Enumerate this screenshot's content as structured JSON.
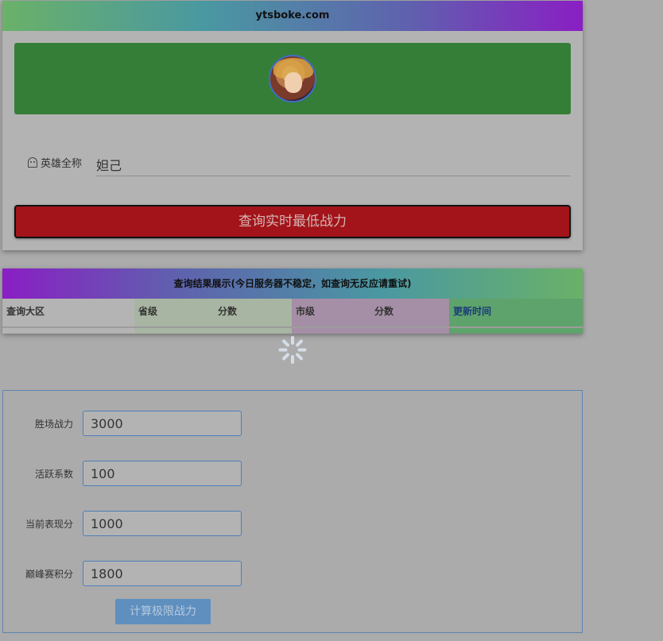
{
  "header": {
    "site_title": "ytsboke.com"
  },
  "hero": {
    "label": "英雄全称",
    "value": "妲己",
    "icon": "ghost-icon"
  },
  "query_button": {
    "label": "查询实时最低战力"
  },
  "results": {
    "title": "查询结果展示(今日服务器不稳定，如查询无反应请重试)",
    "columns": {
      "region": "查询大区",
      "province": "省级",
      "province_score": "分数",
      "city": "市级",
      "city_score": "分数",
      "updated": "更新时间"
    }
  },
  "calculator": {
    "fields": [
      {
        "label": "胜场战力",
        "value": "3000"
      },
      {
        "label": "活跃系数",
        "value": "100"
      },
      {
        "label": "当前表现分",
        "value": "1000"
      },
      {
        "label": "巅峰赛积分",
        "value": "1800"
      }
    ],
    "button_label": "计算极限战力"
  },
  "colors": {
    "accent_green": "#347e38",
    "query_red": "#a21419",
    "calc_blue": "#5e8fbf"
  }
}
